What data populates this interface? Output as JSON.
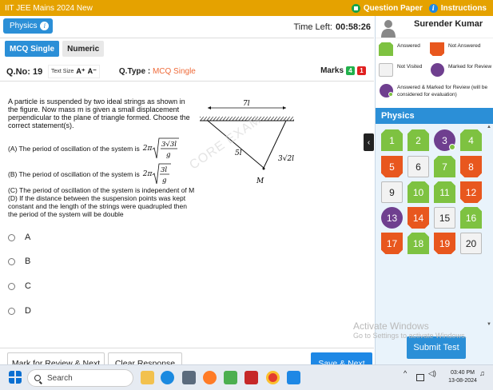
{
  "header": {
    "title": "IIT JEE Mains 2024 New",
    "question_paper": "Question Paper",
    "instructions": "Instructions"
  },
  "section": {
    "name": "Physics",
    "time_left_label": "Time Left:",
    "time_left": "00:58:26"
  },
  "question_types": [
    "MCQ Single",
    "Numeric"
  ],
  "question": {
    "number_label": "Q.No: 19",
    "text_size_label": "Text Size",
    "text_size_up": "A⁺",
    "text_size_down": "A⁻",
    "qtype_label": "Q.Type :",
    "qtype_value": "MCQ Single",
    "marks_label": "Marks",
    "marks_pos": "4",
    "marks_neg": "1",
    "text": "A particle is suspended by two ideal strings as shown in the figure. Now mass m is given a small displacement perpendicular to the plane of triangle formed. Choose the correct statement(s).",
    "stmt_a": "(A) The period of oscillation of the system is",
    "stmt_b": "(B) The period of oscillation of the system is",
    "stmt_c": "(C) The period of oscillation of the system is independent of M",
    "stmt_d": "(D) If the distance between the suspension points was kept constant and the length of the strings were quadrupled then the period of the system will be double",
    "formula_a": {
      "pre": "2π",
      "num": "3√3l",
      "den": "g"
    },
    "formula_b": {
      "pre": "2π",
      "num": "3l",
      "den": "g"
    },
    "diagram": {
      "top_label": "7l",
      "left_label": "5l",
      "right_label": "3√2l",
      "mass_label": "M"
    },
    "watermark": "CORE EXAM",
    "options": [
      "A",
      "B",
      "C",
      "D"
    ]
  },
  "buttons": {
    "mark_review": "Mark for Review & Next",
    "clear": "Clear Response",
    "save_next": "Save & Next",
    "submit": "Submit Test"
  },
  "user": {
    "name": "Surender Kumar"
  },
  "legend": {
    "answered": "Answered",
    "not_answered": "Not Answered",
    "not_visited": "Not Visited",
    "marked_review": "Marked for Review",
    "ans_marked": "Answered & Marked for Review (will be considered for evaluation)"
  },
  "palette": {
    "title": "Physics",
    "items": [
      {
        "n": "1",
        "s": "answered"
      },
      {
        "n": "2",
        "s": "answered"
      },
      {
        "n": "3",
        "s": "ansreview"
      },
      {
        "n": "4",
        "s": "answered"
      },
      {
        "n": "5",
        "s": "notans"
      },
      {
        "n": "6",
        "s": "notvisit"
      },
      {
        "n": "7",
        "s": "answered"
      },
      {
        "n": "8",
        "s": "notans"
      },
      {
        "n": "9",
        "s": "notvisit"
      },
      {
        "n": "10",
        "s": "answered"
      },
      {
        "n": "11",
        "s": "answered"
      },
      {
        "n": "12",
        "s": "notans"
      },
      {
        "n": "13",
        "s": "review"
      },
      {
        "n": "14",
        "s": "notans"
      },
      {
        "n": "15",
        "s": "notvisit"
      },
      {
        "n": "16",
        "s": "answered"
      },
      {
        "n": "17",
        "s": "notans"
      },
      {
        "n": "18",
        "s": "answered"
      },
      {
        "n": "19",
        "s": "notans"
      },
      {
        "n": "20",
        "s": "notvisit"
      }
    ]
  },
  "watermark_os": {
    "line1": "Activate Windows",
    "line2": "Go to Settings to activate Windows."
  },
  "taskbar": {
    "search": "Search",
    "time": "03:40 PM",
    "date": "13-08-2024"
  },
  "colors": {
    "topbar": "#e5a200",
    "accent": "#2b8fd7",
    "answered": "#7ec241",
    "not_answered": "#e8571e",
    "review": "#6f3f8f"
  }
}
